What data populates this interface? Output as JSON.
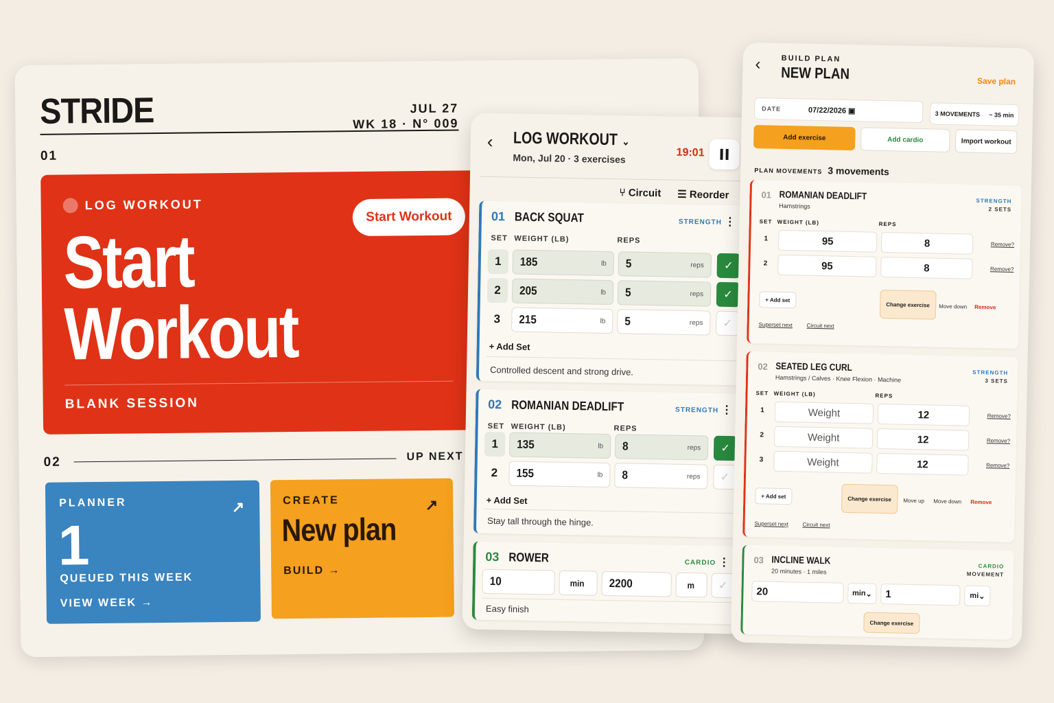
{
  "home": {
    "brand": "STRIDE",
    "date": "JUL 27",
    "week": "WK 18 · N° 009",
    "section1": "01",
    "section2": "02",
    "up_next": "UP NEXT",
    "hero": {
      "kicker": "LOG WORKOUT",
      "title_line1": "Start",
      "title_line2": "Workout",
      "button": "Start Workout",
      "footer": "BLANK SESSION"
    },
    "planner": {
      "label": "PLANNER",
      "count": "1",
      "sub": "QUEUED THIS WEEK",
      "link": "VIEW WEEK →"
    },
    "create": {
      "label": "CREATE",
      "title": "New plan",
      "link": "BUILD →"
    },
    "accent_red": "#e03216",
    "accent_blue": "#3a84c0",
    "accent_orange": "#f5a01e"
  },
  "log": {
    "title": "LOG WORKOUT",
    "meta": "Mon, Jul 20 · 3 exercises",
    "timer": "19:01",
    "circuit": "Circuit",
    "reorder": "Reorder",
    "set_col": "SET",
    "weight_col": "WEIGHT (LB)",
    "reps_col": "REPS",
    "add_set": "+ Add Set",
    "exercises": [
      {
        "no": "01",
        "name": "BACK SQUAT",
        "type": "STRENGTH",
        "sets": [
          {
            "n": "1",
            "weight": "185",
            "wu": "lb",
            "reps": "5",
            "ru": "reps",
            "done": true
          },
          {
            "n": "2",
            "weight": "205",
            "wu": "lb",
            "reps": "5",
            "ru": "reps",
            "done": true
          },
          {
            "n": "3",
            "weight": "215",
            "wu": "lb",
            "reps": "5",
            "ru": "reps",
            "done": false
          }
        ],
        "note": "Controlled descent and strong drive."
      },
      {
        "no": "02",
        "name": "ROMANIAN DEADLIFT",
        "type": "STRENGTH",
        "sets": [
          {
            "n": "1",
            "weight": "135",
            "wu": "lb",
            "reps": "8",
            "ru": "reps",
            "done": true
          },
          {
            "n": "2",
            "weight": "155",
            "wu": "lb",
            "reps": "8",
            "ru": "reps",
            "done": false
          }
        ],
        "note": "Stay tall through the hinge."
      },
      {
        "no": "03",
        "name": "ROWER",
        "type": "CARDIO",
        "cardio": {
          "duration": "10",
          "duration_unit": "min",
          "distance": "2200",
          "distance_unit": "m"
        },
        "note": "Easy finish"
      }
    ]
  },
  "plan": {
    "kicker": "BUILD PLAN",
    "title": "NEW PLAN",
    "save": "Save plan",
    "date_label": "DATE",
    "date": "07/22/2026",
    "movements_count": "3 MOVEMENTS",
    "duration": "~ 35 min",
    "add_exercise": "Add exercise",
    "add_cardio": "Add cardio",
    "import_workout": "Import workout",
    "plan_movements_label": "PLAN MOVEMENTS",
    "plan_movements_value": "3 movements",
    "set_col": "SET",
    "weight_col": "WEIGHT (LB)",
    "reps_col": "REPS",
    "add_set": "+ Add set",
    "change_exercise": "Change exercise",
    "move_up": "Move up",
    "move_down": "Move down",
    "remove": "Remove",
    "remove_q": "Remove?",
    "superset_next": "Superset next",
    "circuit_next": "Circuit next",
    "items": [
      {
        "no": "01",
        "name": "ROMANIAN DEADLIFT",
        "tags": "Hamstrings",
        "type": "STRENGTH",
        "count": "2 SETS",
        "sets": [
          {
            "n": "1",
            "weight": "95",
            "reps": "8"
          },
          {
            "n": "2",
            "weight": "95",
            "reps": "8"
          }
        ]
      },
      {
        "no": "02",
        "name": "SEATED LEG CURL",
        "tags": "Hamstrings / Calves · Knee Flexion · Machine",
        "type": "STRENGTH",
        "count": "3 SETS",
        "weight_placeholder": "Weight",
        "sets": [
          {
            "n": "1",
            "reps": "12"
          },
          {
            "n": "2",
            "reps": "12"
          },
          {
            "n": "3",
            "reps": "12"
          }
        ]
      },
      {
        "no": "03",
        "name": "INCLINE WALK",
        "tags": "20 minutes · 1 miles",
        "type": "CARDIO",
        "count": "MOVEMENT",
        "cardio": {
          "duration": "20",
          "duration_unit": "min",
          "distance": "1",
          "distance_unit": "mi"
        }
      }
    ]
  }
}
